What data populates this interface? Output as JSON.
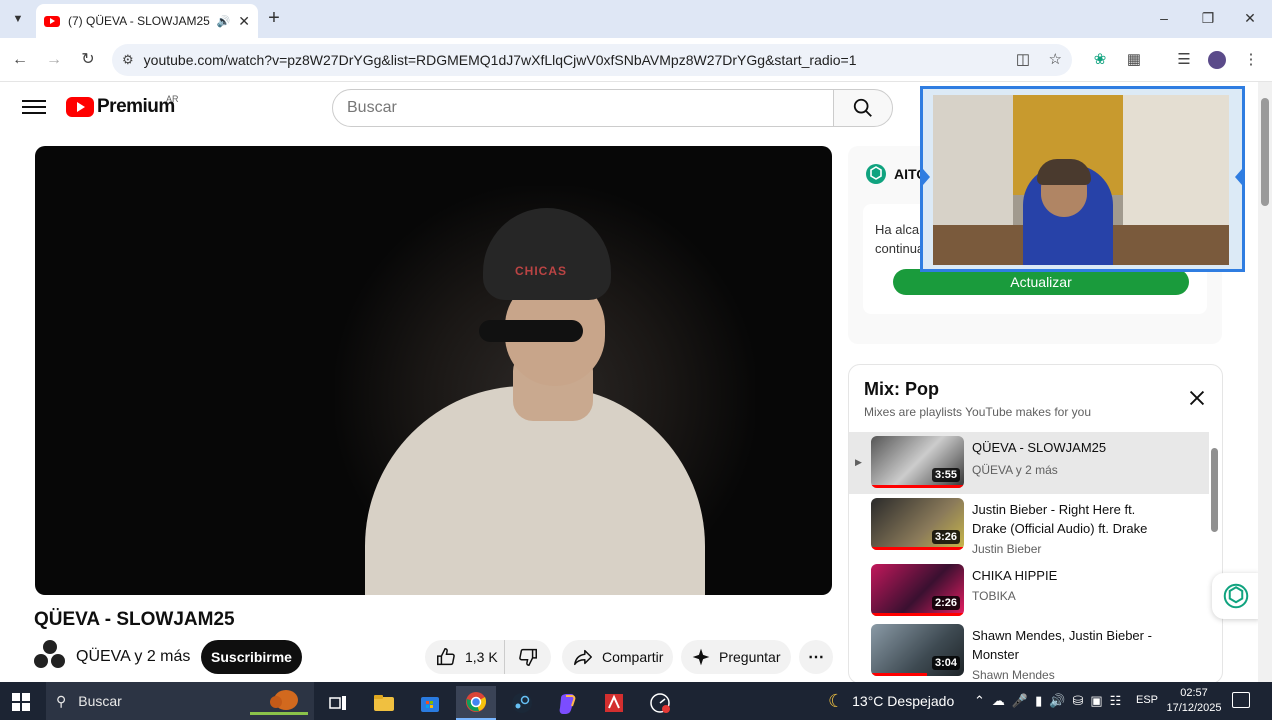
{
  "browser": {
    "tab_title": "(7) QÜEVA - SLOWJAM25 -",
    "url": "youtube.com/watch?v=pz8W27DrYGg&list=RDGMEMQ1dJ7wXfLlqCjwV0xfSNbAVMpz8W27DrYGg&start_radio=1"
  },
  "youtube": {
    "logo_text": "Premium",
    "country_code": "AR",
    "search_placeholder": "Buscar"
  },
  "video": {
    "cap_text": "CHICAS",
    "title": "QÜEVA - SLOWJAM25",
    "channel": "QÜEVA y 2 más",
    "subscribe_label": "Suscribirme",
    "likes": "1,3 K",
    "share_label": "Compartir",
    "ask_label": "Preguntar"
  },
  "extension_card": {
    "name": "AITO",
    "message_line1": "Ha alcar",
    "message_line2": "continua",
    "button_label": "Actualizar",
    "button_color": "#1a9b3c"
  },
  "mix": {
    "title": "Mix: Pop",
    "subtitle": "Mixes are playlists YouTube makes for you",
    "items": [
      {
        "title": "QÜEVA - SLOWJAM25",
        "channel": "QÜEVA y 2 más",
        "duration": "3:55",
        "active": true,
        "progress": 1.0
      },
      {
        "title": "Justin Bieber - Right Here ft. Drake (Official Audio) ft. Drake",
        "channel": "Justin Bieber",
        "duration": "3:26",
        "active": false,
        "progress": 1.0
      },
      {
        "title": "CHIKA HIPPIE",
        "channel": "TOBIKA",
        "duration": "2:26",
        "active": false,
        "progress": 1.0
      },
      {
        "title": "Shawn Mendes, Justin Bieber - Monster",
        "channel": "Shawn Mendes",
        "duration": "3:04",
        "active": false,
        "progress": 0.6
      }
    ]
  },
  "taskbar": {
    "search_placeholder": "Buscar",
    "weather": "13°C  Despejado",
    "language": "ESP",
    "time": "02:57",
    "date": "17/12/2025"
  },
  "colors": {
    "youtube_red": "#ff0000",
    "webcam_border": "#2f7de1",
    "taskbar_bg": "#1c2433"
  }
}
